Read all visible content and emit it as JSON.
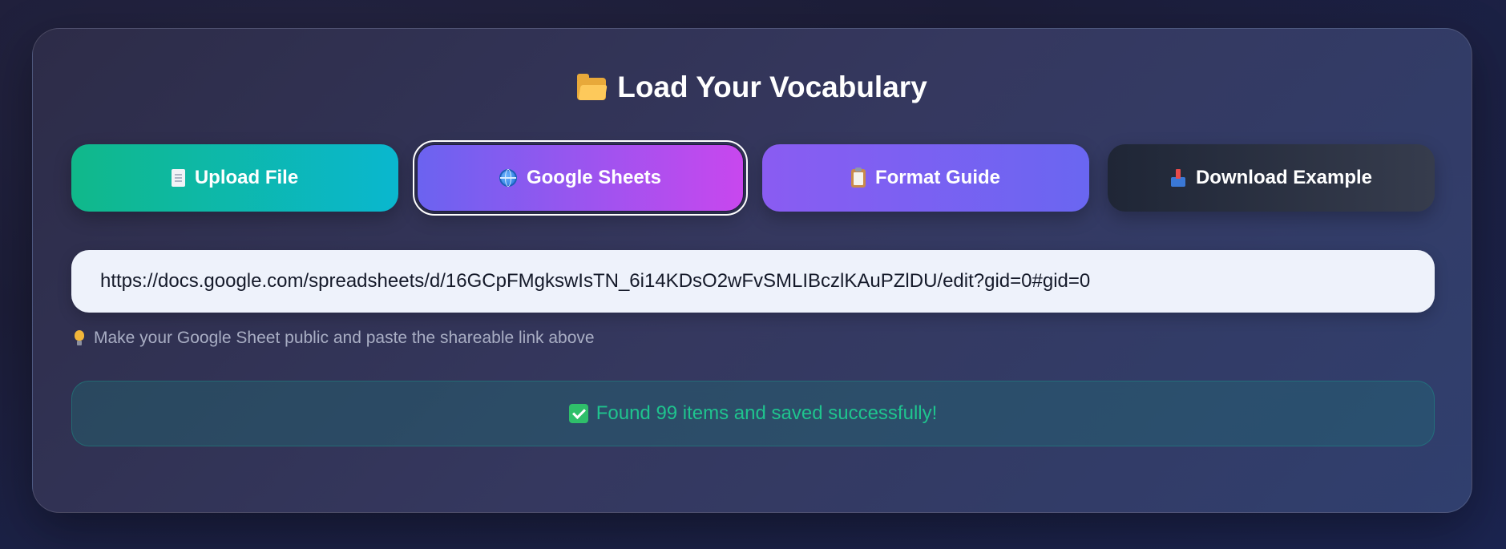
{
  "panel": {
    "title": "Load Your Vocabulary",
    "title_icon": "folder-icon"
  },
  "buttons": [
    {
      "label": "Upload File",
      "icon": "document-icon"
    },
    {
      "label": "Google Sheets",
      "icon": "globe-icon",
      "selected": true
    },
    {
      "label": "Format Guide",
      "icon": "clipboard-icon"
    },
    {
      "label": "Download Example",
      "icon": "inbox-tray-icon"
    }
  ],
  "url_input": {
    "value": "https://docs.google.com/spreadsheets/d/16GCpFMgkswIsTN_6i14KDsO2wFvSMLIBczlKAuPZlDU/edit?gid=0#gid=0"
  },
  "hint": {
    "icon": "lightbulb-icon",
    "text": "Make your Google Sheet public and paste the shareable link above"
  },
  "status": {
    "icon": "check-icon",
    "text": "Found 99 items and saved successfully!",
    "color": "#1fc48e"
  }
}
